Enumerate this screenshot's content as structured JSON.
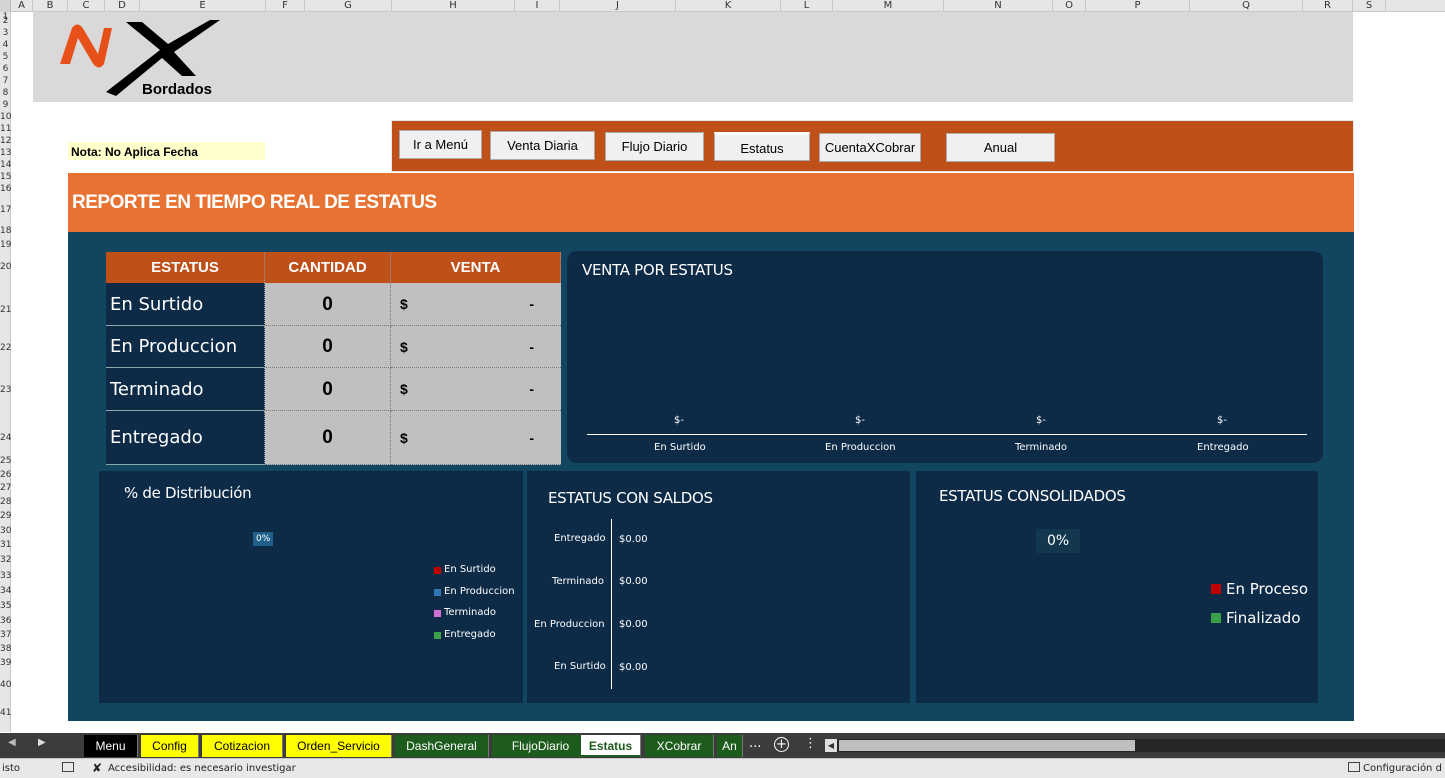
{
  "columns": [
    "A",
    "B",
    "C",
    "D",
    "E",
    "F",
    "G",
    "H",
    "I",
    "J",
    "K",
    "L",
    "M",
    "N",
    "O",
    "P",
    "Q",
    "R",
    "S"
  ],
  "rows": [
    "1",
    "2",
    "3",
    "4",
    "5",
    "6",
    "7",
    "8",
    "9",
    "10",
    "11",
    "12",
    "13",
    "14",
    "15",
    "16",
    "17",
    "18",
    "19",
    "20",
    "21",
    "22",
    "23",
    "24",
    "25",
    "26",
    "27",
    "28",
    "29",
    "30",
    "31",
    "32",
    "33",
    "34",
    "35",
    "36",
    "37",
    "38",
    "39",
    "40",
    "41"
  ],
  "logo": {
    "brand": "NX",
    "sub": "Bordados"
  },
  "note": "Nota: No Aplica Fecha",
  "nav": [
    "Ir a Menú",
    "Venta Diaria",
    "Flujo Diario",
    "Estatus",
    "CuentaXCobrar",
    "Anual"
  ],
  "title": "REPORTE EN TIEMPO REAL DE ESTATUS",
  "table": {
    "headers": [
      "ESTATUS",
      "CANTIDAD",
      "VENTA"
    ],
    "rows": [
      {
        "name": "En Surtido",
        "qty": "0",
        "cur": "$",
        "val": "-"
      },
      {
        "name": "En Produccion",
        "qty": "0",
        "cur": "$",
        "val": "-"
      },
      {
        "name": "Terminado",
        "qty": "0",
        "cur": "$",
        "val": "-"
      },
      {
        "name": "Entregado",
        "qty": "0",
        "cur": "$",
        "val": "-"
      }
    ]
  },
  "venta_chart": {
    "title": "VENTA POR ESTATUS",
    "categories": [
      "En Surtido",
      "En Produccion",
      "Terminado",
      "Entregado"
    ],
    "labels": [
      "$-",
      "$-",
      "$-",
      "$-"
    ]
  },
  "dist_chart": {
    "title": "% de Distribución",
    "label": "0%",
    "legend": [
      "En Surtido",
      "En Produccion",
      "Terminado",
      "Entregado"
    ],
    "colors": [
      "#c00000",
      "#2e75b6",
      "#d36fd3",
      "#3aa04a"
    ]
  },
  "saldos_chart": {
    "title": "ESTATUS CON SALDOS",
    "categories": [
      "Entregado",
      "Terminado",
      "En Produccion",
      "En Surtido"
    ],
    "values": [
      "$0.00",
      "$0.00",
      "$0.00",
      "$0.00"
    ]
  },
  "consol_chart": {
    "title": "ESTATUS CONSOLIDADOS",
    "label": "0%",
    "legend": [
      "En Proceso",
      "Finalizado"
    ],
    "colors": [
      "#c00000",
      "#3aa04a"
    ]
  },
  "chart_data": [
    {
      "type": "bar",
      "title": "VENTA POR ESTATUS",
      "categories": [
        "En Surtido",
        "En Produccion",
        "Terminado",
        "Entregado"
      ],
      "values": [
        0,
        0,
        0,
        0
      ],
      "data_labels": [
        "$-",
        "$-",
        "$-",
        "$-"
      ]
    },
    {
      "type": "pie",
      "title": "% de Distribución",
      "categories": [
        "En Surtido",
        "En Produccion",
        "Terminado",
        "Entregado"
      ],
      "values": [
        0,
        0,
        0,
        0
      ],
      "data_labels": [
        "0%"
      ]
    },
    {
      "type": "bar",
      "title": "ESTATUS CON SALDOS",
      "categories": [
        "Entregado",
        "Terminado",
        "En Produccion",
        "En Surtido"
      ],
      "values": [
        0,
        0,
        0,
        0
      ],
      "data_labels": [
        "$0.00",
        "$0.00",
        "$0.00",
        "$0.00"
      ]
    },
    {
      "type": "pie",
      "title": "ESTATUS CONSOLIDADOS",
      "categories": [
        "En Proceso",
        "Finalizado"
      ],
      "values": [
        0,
        0
      ],
      "data_labels": [
        "0%"
      ]
    }
  ],
  "sheet_tabs": [
    {
      "label": "Menu",
      "bg": "#000000",
      "fg": "#ffffff"
    },
    {
      "label": "Config",
      "bg": "#ffff00",
      "fg": "#000000"
    },
    {
      "label": "Cotizacion",
      "bg": "#ffff00",
      "fg": "#000000"
    },
    {
      "label": "Orden_Servicio",
      "bg": "#ffff00",
      "fg": "#000000"
    },
    {
      "label": "DashGeneral",
      "bg": "#1e5c1e",
      "fg": "#ffffff"
    },
    {
      "label": "FlujoDiario",
      "bg": "#1e5c1e",
      "fg": "#ffffff"
    },
    {
      "label": "Estatus",
      "bg": "#ffffff",
      "fg": "#1e5c1e"
    },
    {
      "label": "XCobrar",
      "bg": "#1e5c1e",
      "fg": "#ffffff"
    },
    {
      "label": "An",
      "bg": "#1e5c1e",
      "fg": "#ffffff"
    }
  ],
  "tabs_more": "...",
  "status": {
    "left": "isto",
    "accessibility": "Accesibilidad: es necesario investigar",
    "right": "Configuración d"
  }
}
